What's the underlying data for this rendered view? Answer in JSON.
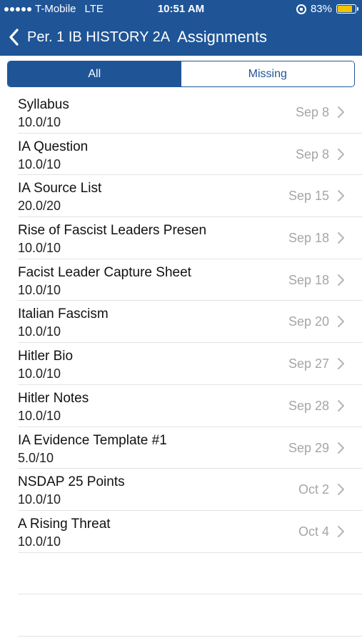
{
  "status": {
    "carrier": "T-Mobile",
    "network": "LTE",
    "time": "10:51 AM",
    "battery": "83%",
    "battery_level": 0.83
  },
  "nav": {
    "back_label": "Per. 1 IB HISTORY 2A",
    "title": "Assignments"
  },
  "tabs": [
    {
      "label": "All",
      "active": true
    },
    {
      "label": "Missing",
      "active": false
    }
  ],
  "assignments": [
    {
      "title": "Syllabus",
      "score": "10.0/10",
      "date": "Sep 8"
    },
    {
      "title": "IA Question",
      "score": "10.0/10",
      "date": "Sep 8"
    },
    {
      "title": "IA Source List",
      "score": "20.0/20",
      "date": "Sep 15"
    },
    {
      "title": "Rise of Fascist Leaders Presen",
      "score": "10.0/10",
      "date": "Sep 18"
    },
    {
      "title": "Facist Leader Capture Sheet",
      "score": "10.0/10",
      "date": "Sep 18"
    },
    {
      "title": "Italian Fascism",
      "score": "10.0/10",
      "date": "Sep 20"
    },
    {
      "title": "Hitler Bio",
      "score": "10.0/10",
      "date": "Sep 27"
    },
    {
      "title": "Hitler Notes",
      "score": "10.0/10",
      "date": "Sep 28"
    },
    {
      "title": "IA Evidence Template #1",
      "score": "5.0/10",
      "date": "Sep 29"
    },
    {
      "title": "NSDAP 25 Points",
      "score": "10.0/10",
      "date": "Oct 2"
    },
    {
      "title": "A Rising Threat",
      "score": "10.0/10",
      "date": "Oct 4"
    }
  ],
  "colors": {
    "brand": "#1f5597",
    "date_text": "#a6a6a6",
    "battery": "#f5c400"
  }
}
